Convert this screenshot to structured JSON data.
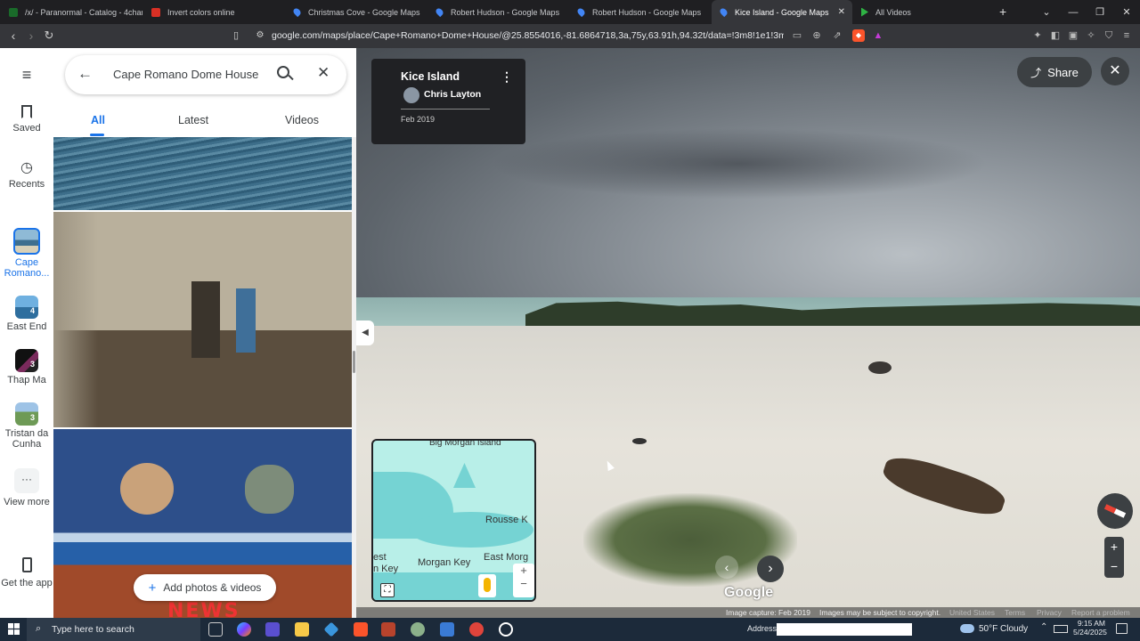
{
  "browser": {
    "tabs": [
      {
        "label": "/x/ - Paranormal - Catalog - 4chan",
        "icon_color": "#1a6b2a"
      },
      {
        "label": "Invert colors online",
        "icon_color": "#d93025"
      },
      {
        "label": "Christmas Cove - Google Maps",
        "icon_color": "#4285f4"
      },
      {
        "label": "Robert Hudson - Google Maps",
        "icon_color": "#4285f4"
      },
      {
        "label": "Robert Hudson - Google Maps",
        "icon_color": "#4285f4"
      },
      {
        "label": "Kice Island - Google Maps",
        "icon_color": "#4285f4",
        "active": true
      },
      {
        "label": "All Videos",
        "icon_color": "#2fb344"
      }
    ],
    "new_tab": "+",
    "url": "google.com/maps/place/Cape+Romano+Dome+House/@25.8554016,-81.6864718,3a,75y,63.91h,94.32t/data=!3m8!1e1!3m6!1sCIHM0og..."
  },
  "rail": {
    "menu_icon": "menu-icon",
    "items": [
      {
        "label": "Saved",
        "icon": "bookmark-icon"
      },
      {
        "label": "Recents",
        "icon": "history-icon"
      },
      {
        "label": "Cape Romano...",
        "thumb_color": "#6fa7c9",
        "active": true
      },
      {
        "label": "East End",
        "badge": "4",
        "thumb_color": "#4a90c2"
      },
      {
        "label": "Thap Ma",
        "badge": "3",
        "thumb_color": "#2b2b2b"
      },
      {
        "label": "Tristan da Cunha",
        "badge": "3",
        "thumb_color": "#7aa66a"
      },
      {
        "label": "View more",
        "icon": "more-icon"
      },
      {
        "label": "Get the app",
        "icon": "phone-icon"
      }
    ]
  },
  "panel": {
    "search_value": "Cape Romano Dome House",
    "tabs": [
      "All",
      "Latest",
      "Videos"
    ],
    "add_photos_label": "Add photos & videos",
    "news_text": "NEWS"
  },
  "streetview": {
    "place_title": "Kice Island",
    "author": "Chris Layton",
    "date": "Feb 2019",
    "share_label": "Share",
    "map_labels": [
      "Big Morgan Island",
      "Rousse K",
      "Morgan Key",
      "East Morg",
      "est",
      "n Key"
    ],
    "attribution": {
      "google": "Google",
      "capture": "Image capture: Feb 2019",
      "copyright": "Images may be subject to copyright.",
      "country": "United States",
      "terms": "Terms",
      "privacy": "Privacy",
      "report": "Report a problem"
    }
  },
  "taskbar": {
    "search_placeholder": "Type here to search",
    "address_label": "Address",
    "weather": "50°F  Cloudy",
    "time": "9:15 AM",
    "date": "5/24/2025"
  }
}
